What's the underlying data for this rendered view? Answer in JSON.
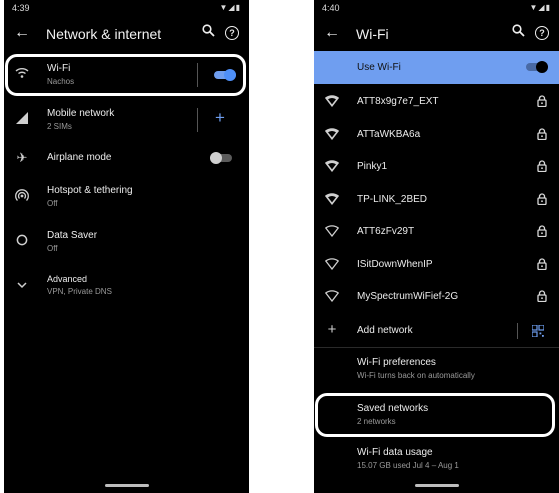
{
  "left": {
    "status": {
      "time": "4:39",
      "icons": "▼◢▮"
    },
    "appbar": {
      "title": "Network & internet",
      "back_icon": "←",
      "search_icon": "⚲",
      "help_icon": "?"
    },
    "items": [
      {
        "title": "Wi-Fi",
        "subtitle": "Nachos",
        "icon": "wifi-icon",
        "toggle": "on"
      },
      {
        "title": "Mobile network",
        "subtitle": "2 SIMs",
        "icon": "signal-icon",
        "action": "+"
      },
      {
        "title": "Airplane mode",
        "subtitle": "",
        "icon": "airplane-icon",
        "toggle": "off"
      },
      {
        "title": "Hotspot & tethering",
        "subtitle": "Off",
        "icon": "hotspot-icon"
      },
      {
        "title": "Data Saver",
        "subtitle": "Off",
        "icon": "data-saver-icon"
      },
      {
        "title": "Advanced",
        "subtitle": "VPN, Private DNS",
        "icon": "chevron-down-icon"
      }
    ]
  },
  "right": {
    "status": {
      "time": "4:40",
      "icons": "▼◢▮"
    },
    "appbar": {
      "title": "Wi-Fi",
      "back_icon": "←",
      "search_icon": "⚲",
      "help_icon": "?"
    },
    "use_wifi": {
      "label": "Use Wi-Fi",
      "toggle": "on"
    },
    "networks": [
      {
        "name": "ATT8x9g7e7_EXT",
        "signal": "full"
      },
      {
        "name": "ATTaWKBA6a",
        "signal": "full"
      },
      {
        "name": "Pinky1",
        "signal": "full"
      },
      {
        "name": "TP-LINK_2BED",
        "signal": "full"
      },
      {
        "name": "ATT6zFv29T",
        "signal": "weak"
      },
      {
        "name": "ISitDownWhenIP",
        "signal": "weak"
      },
      {
        "name": "MySpectrumWiFief-2G",
        "signal": "weak"
      }
    ],
    "add_network": {
      "label": "Add network",
      "plus": "+",
      "qr_icon": "qr-code-icon"
    },
    "preferences": {
      "title": "Wi-Fi preferences",
      "subtitle": "Wi-Fi turns back on automatically"
    },
    "saved": {
      "title": "Saved networks",
      "subtitle": "2 networks"
    },
    "usage": {
      "title": "Wi-Fi data usage",
      "subtitle": "15.07 GB used Jul 4 – Aug 1"
    }
  },
  "colors": {
    "accent": "#4f8ff7",
    "highlight_bar": "#6f9ef0",
    "toggle_off_track": "#5b5b5b",
    "toggle_off_knob": "#d0d0d0"
  }
}
